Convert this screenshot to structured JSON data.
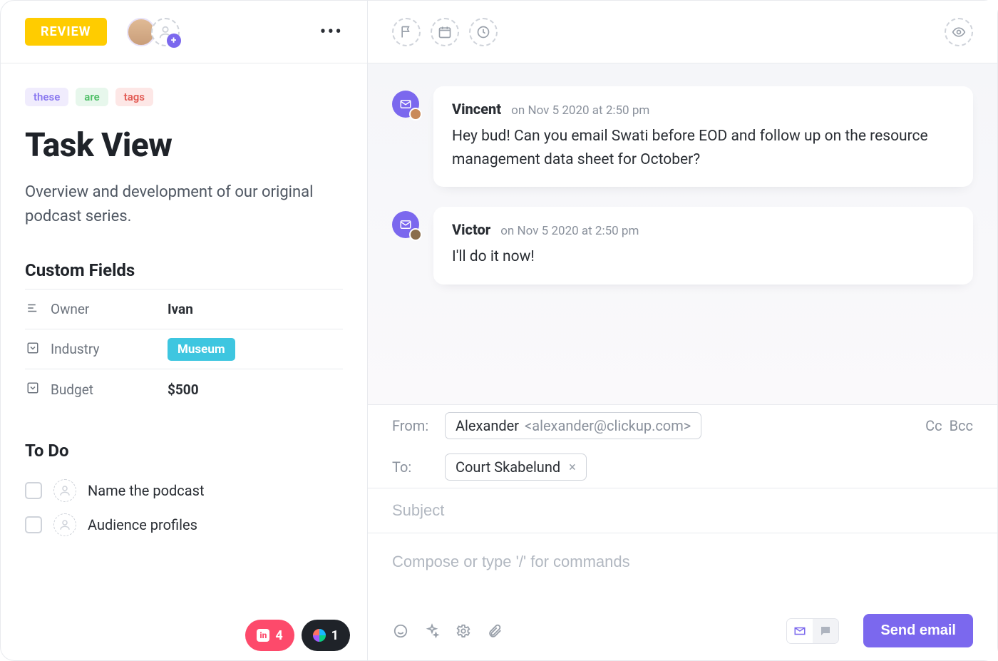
{
  "status_label": "REVIEW",
  "tags": [
    "these",
    "are",
    "tags"
  ],
  "task_title": "Task View",
  "task_description": "Overview and development of our original podcast series.",
  "custom_fields_heading": "Custom Fields",
  "fields": {
    "owner_label": "Owner",
    "owner_value": "Ivan",
    "industry_label": "Industry",
    "industry_value": "Museum",
    "budget_label": "Budget",
    "budget_value": "$500"
  },
  "todo_heading": "To Do",
  "todos": [
    {
      "label": "Name the podcast"
    },
    {
      "label": "Audience profiles"
    }
  ],
  "dock": {
    "invision_count": "4",
    "figma_count": "1"
  },
  "messages": [
    {
      "author": "Vincent",
      "timestamp": "on Nov 5 2020 at 2:50 pm",
      "body": "Hey bud! Can you email Swati before EOD and follow up on the resource management data sheet for October?"
    },
    {
      "author": "Victor",
      "timestamp": "on Nov 5 2020 at 2:50 pm",
      "body": "I'll do it now!"
    }
  ],
  "composer": {
    "from_label": "From:",
    "to_label": "To:",
    "from_name": "Alexander",
    "from_addr": "<alexander@clickup.com>",
    "to_name": "Court Skabelund",
    "cc_label": "Cc",
    "bcc_label": "Bcc",
    "subject_placeholder": "Subject",
    "body_placeholder": "Compose or type '/' for commands",
    "send_label": "Send email"
  }
}
